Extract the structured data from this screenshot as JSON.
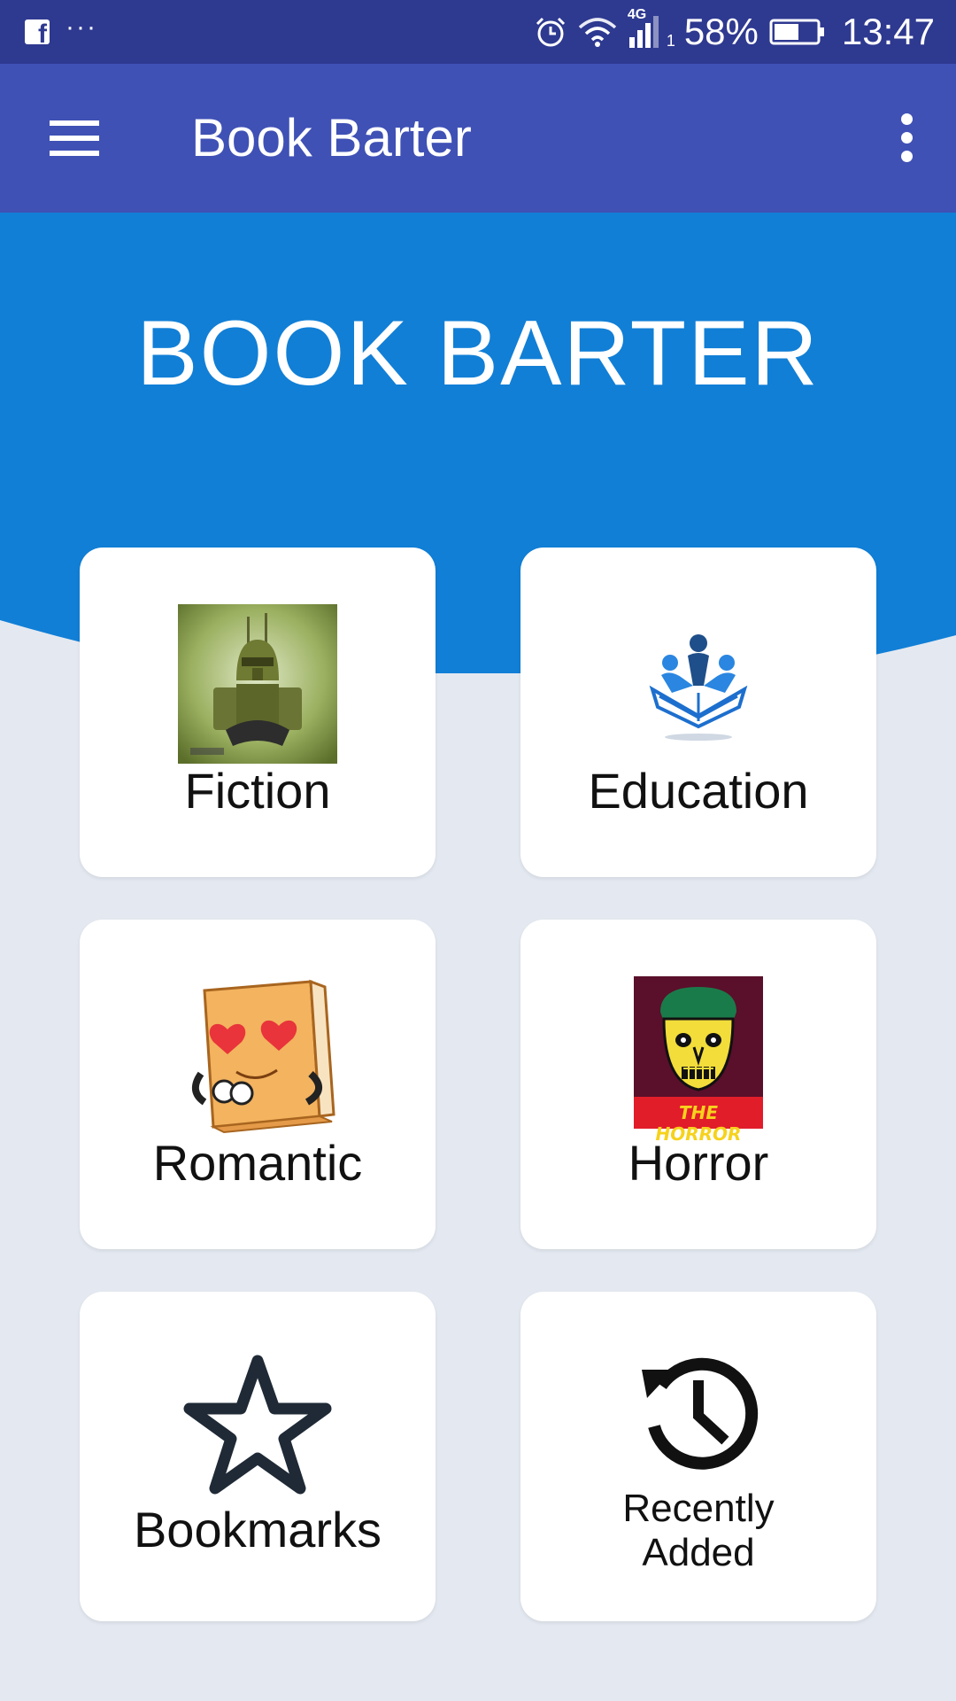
{
  "status_bar": {
    "dots": "···",
    "battery_percent": "58%",
    "time": "13:47",
    "network_label": "4G",
    "sim_slot": "1",
    "icons": [
      "facebook-icon",
      "alarm-icon",
      "wifi-icon",
      "signal-icon",
      "battery-icon"
    ]
  },
  "app_bar": {
    "title": "Book Barter",
    "menu_icon": "hamburger-menu-icon",
    "overflow_icon": "more-vertical-icon"
  },
  "hero": {
    "title": "BOOK BARTER"
  },
  "categories": [
    {
      "label": "Fiction",
      "icon": "robot-soldier-image"
    },
    {
      "label": "Education",
      "icon": "education-book-icon"
    },
    {
      "label": "Romantic",
      "icon": "book-in-love-image"
    },
    {
      "label": "Horror",
      "icon": "horror-poster-image",
      "poster_text": "THE HORROR"
    },
    {
      "label": "Bookmarks",
      "icon": "star-icon"
    },
    {
      "label_line1": "Recently",
      "label_line2": "Added",
      "icon": "history-icon"
    }
  ],
  "colors": {
    "status_bar": "#2e3990",
    "app_bar": "#3f51b5",
    "hero": "#117fd6",
    "background": "#e4e9f1",
    "card": "#ffffff"
  }
}
